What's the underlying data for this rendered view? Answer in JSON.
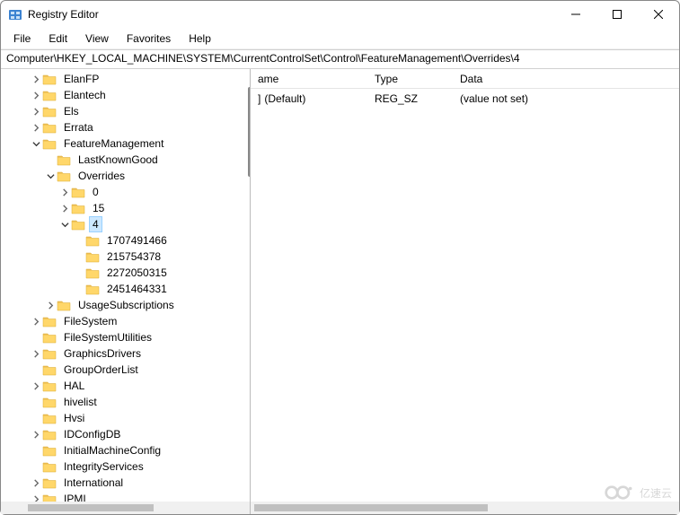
{
  "titlebar": {
    "title": "Registry Editor"
  },
  "menu": {
    "file": "File",
    "edit": "Edit",
    "view": "View",
    "favorites": "Favorites",
    "help": "Help"
  },
  "path": "Computer\\HKEY_LOCAL_MACHINE\\SYSTEM\\CurrentControlSet\\Control\\FeatureManagement\\Overrides\\4",
  "tree": {
    "elanfp": "ElanFP",
    "elantech": "Elantech",
    "els": "Els",
    "errata": "Errata",
    "featuremgmt": "FeatureManagement",
    "lastknowngood": "LastKnownGood",
    "overrides": "Overrides",
    "k0": "0",
    "k15": "15",
    "k4": "4",
    "sub1": "1707491466",
    "sub2": "215754378",
    "sub3": "2272050315",
    "sub4": "2451464331",
    "usagesubs": "UsageSubscriptions",
    "filesystem": "FileSystem",
    "fsutil": "FileSystemUtilities",
    "graphics": "GraphicsDrivers",
    "grouporder": "GroupOrderList",
    "hal": "HAL",
    "hivelist": "hivelist",
    "hvsi": "Hvsi",
    "idconfig": "IDConfigDB",
    "initmachine": "InitialMachineConfig",
    "integrity": "IntegrityServices",
    "intl": "International",
    "ipmi": "IPMI"
  },
  "list": {
    "hdr_name": "ame",
    "hdr_type": "Type",
    "hdr_data": "Data",
    "row1_name": "(Default)",
    "row1_name_clip": "]",
    "row1_type": "REG_SZ",
    "row1_data": "(value not set)"
  },
  "watermark": "亿速云"
}
